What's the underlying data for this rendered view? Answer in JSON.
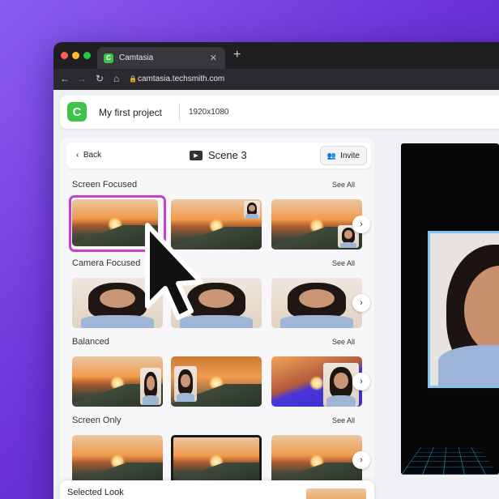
{
  "browser": {
    "tab_title": "Camtasia",
    "tab_icon_letter": "C",
    "close_glyph": "✕",
    "new_tab_glyph": "+",
    "url": "camtasia.techsmith.com"
  },
  "app": {
    "logo_letter": "C",
    "project_name": "My first project",
    "resolution": "1920x1080"
  },
  "scene": {
    "back_label": "Back",
    "title": "Scene 3",
    "invite_label": "Invite"
  },
  "sections": [
    {
      "title": "Screen Focused",
      "see_all": "See All"
    },
    {
      "title": "Camera Focused",
      "see_all": "See All"
    },
    {
      "title": "Balanced",
      "see_all": "See All"
    },
    {
      "title": "Screen Only",
      "see_all": "See All"
    }
  ],
  "footer": {
    "selected_look_label": "Selected Look"
  },
  "colors": {
    "accent_green": "#3ec24a",
    "selection": "#c83fcf",
    "grid_blue": "#3caae6"
  },
  "icons": {
    "back": "chevron-left-icon",
    "next": "chevron-right-icon",
    "scene": "video-scene-icon",
    "invite": "users-icon",
    "pointer": "mouse-pointer-icon"
  }
}
